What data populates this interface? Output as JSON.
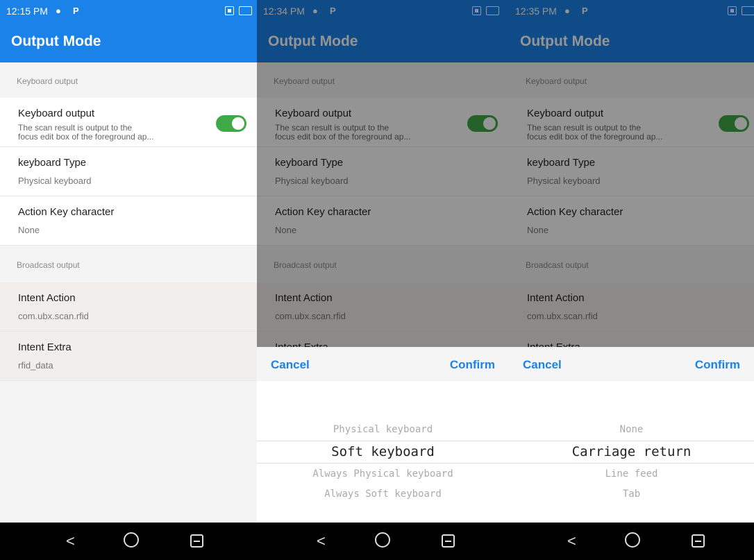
{
  "screens": [
    {
      "time": "12:15 PM",
      "title": "Output Mode",
      "section1": "Keyboard output",
      "kb_title": "Keyboard output",
      "kb_desc1": "The scan result is output to the",
      "kb_desc2": "focus edit box of the foreground ap...",
      "type_title": "keyboard Type",
      "type_value": "Physical keyboard",
      "action_title": "Action Key character",
      "action_value": "None",
      "section2": "Broadcast output",
      "intent_title": "Intent Action",
      "intent_value": "com.ubx.scan.rfid",
      "extra_title": "Intent Extra",
      "extra_value": "rfid_data"
    },
    {
      "time": "12:34 PM",
      "title": "Output Mode",
      "section1": "Keyboard output",
      "kb_title": "Keyboard output",
      "kb_desc1": "The scan result is output to the",
      "kb_desc2": "focus edit box of the foreground ap...",
      "type_title": "keyboard Type",
      "type_value": "Physical keyboard",
      "action_title": "Action Key character",
      "action_value": "None",
      "section2": "Broadcast output",
      "intent_title": "Intent Action",
      "intent_value": "com.ubx.scan.rfid",
      "extra_title": "Intent Extra",
      "cancel": "Cancel",
      "confirm": "Confirm",
      "options": [
        "Physical keyboard",
        "Soft keyboard",
        "Always Physical keyboard",
        "Always Soft keyboard"
      ],
      "selected": "Soft keyboard"
    },
    {
      "time": "12:35 PM",
      "title": "Output Mode",
      "section1": "Keyboard output",
      "kb_title": "Keyboard output",
      "kb_desc1": "The scan result is output to the",
      "kb_desc2": "focus edit box of the foreground ap...",
      "type_title": "keyboard Type",
      "type_value": "Physical keyboard",
      "action_title": "Action Key character",
      "action_value": "None",
      "section2": "Broadcast output",
      "intent_title": "Intent Action",
      "intent_value": "com.ubx.scan.rfid",
      "extra_title": "Intent Extra",
      "cancel": "Cancel",
      "confirm": "Confirm",
      "options": [
        "None",
        "Carriage return",
        "Line feed",
        "Tab"
      ],
      "selected": "Carriage return"
    }
  ],
  "colors": {
    "accent": "#1a82e8",
    "toggle_on": "#3fa847"
  },
  "icons": [
    "shield-icon",
    "parking-icon",
    "sim-icon",
    "battery-charging-icon",
    "back-icon",
    "home-icon",
    "recents-icon"
  ]
}
